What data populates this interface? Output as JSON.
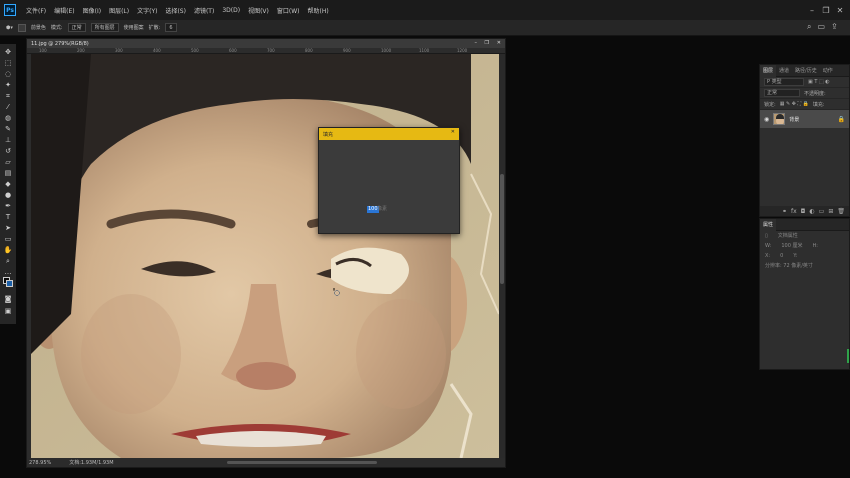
{
  "app": {
    "logo": "Ps",
    "menus": [
      "文件(F)",
      "编辑(E)",
      "图像(I)",
      "图层(L)",
      "文字(Y)",
      "选择(S)",
      "滤镜(T)",
      "3D(D)",
      "视图(V)",
      "窗口(W)",
      "帮助(H)"
    ]
  },
  "options_bar": {
    "mode_label": "前景色",
    "blend_label": "模式:",
    "blend_value": "正常",
    "opacity_label": "所有图层",
    "sample_label": "使用图案",
    "spread_label": "扩散:",
    "spread_value": "6"
  },
  "document": {
    "tab_title": "11.jpg @ 279%(RGB/8)",
    "ruler_ticks": [
      "100",
      "200",
      "300",
      "400",
      "500",
      "600",
      "700",
      "800",
      "900",
      "1000",
      "1100",
      "1200"
    ],
    "zoom": "278.95%",
    "doc_info": "文档:1.93M/1.93M"
  },
  "dialog": {
    "title": "填充",
    "value_selected": "100",
    "value_rest": "像素"
  },
  "layers_panel": {
    "tabs": [
      "图层",
      "通道",
      "路径/历史",
      "动作"
    ],
    "search_placeholder": "P 类型",
    "blend_mode": "正常",
    "opacity_label": "不透明度:",
    "lock_label": "锁定:",
    "fill_label": "填充:",
    "layer_name": "背景"
  },
  "properties_panel": {
    "title": "属性",
    "subtitle": "文档属性",
    "w_label": "W:",
    "w_value": "100 厘米",
    "h_label": "H:",
    "h_value": "0",
    "x_label": "X:",
    "y_label": "Y:",
    "resolution": "分辨率: 72 像素/英寸"
  },
  "colors": {
    "menubar": "#1b1b1b",
    "dialog_title": "#e6b913",
    "selection": "#2a76d6",
    "fg_swatch": "#0a0a0a",
    "bg_swatch": "#1b5fa8"
  }
}
